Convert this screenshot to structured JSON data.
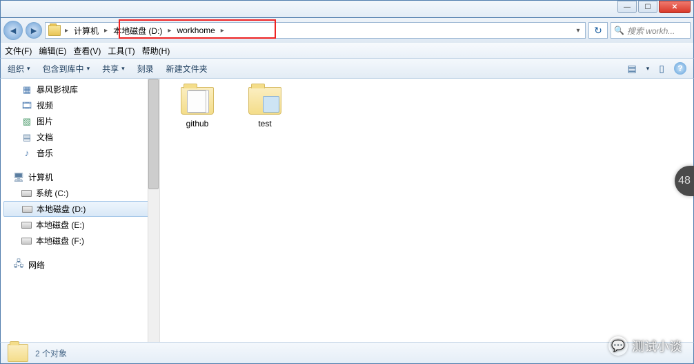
{
  "window": {
    "min_icon": "—",
    "max_icon": "☐",
    "close_icon": "✕"
  },
  "nav": {
    "back_icon": "◄",
    "fwd_icon": "►"
  },
  "breadcrumbs": {
    "root_sep": "▸",
    "computer": "计算机",
    "sep1": "▸",
    "drive": "本地磁盘 (D:)",
    "sep2": "▸",
    "folder": "workhome",
    "sep3": "▸",
    "drop_icon": "▾"
  },
  "refresh_icon": "↻",
  "search": {
    "placeholder": "搜索 workh...",
    "icon": "🔍"
  },
  "menu": {
    "file": "文件(F)",
    "edit": "编辑(E)",
    "view": "查看(V)",
    "tools": "工具(T)",
    "help": "帮助(H)"
  },
  "toolbar": {
    "organize": "组织",
    "include": "包含到库中",
    "share": "共享",
    "burn": "刻录",
    "newfolder": "新建文件夹",
    "drop": "▾",
    "view_icon": "▤",
    "preview_icon": "▯",
    "help": "?"
  },
  "sidebar": {
    "lib": {
      "bf": "暴风影视库",
      "video": "视频",
      "pic": "图片",
      "doc": "文档",
      "music": "音乐"
    },
    "computer_label": "计算机",
    "drives": {
      "c": "系统 (C:)",
      "d": "本地磁盘 (D:)",
      "e": "本地磁盘 (E:)",
      "f": "本地磁盘 (F:)"
    },
    "network_label": "网络"
  },
  "files": {
    "github": "github",
    "test": "test"
  },
  "status": {
    "text": "2 个对象"
  },
  "watermark": {
    "text": "测试小谈",
    "icon": "💬"
  },
  "badge": "48"
}
